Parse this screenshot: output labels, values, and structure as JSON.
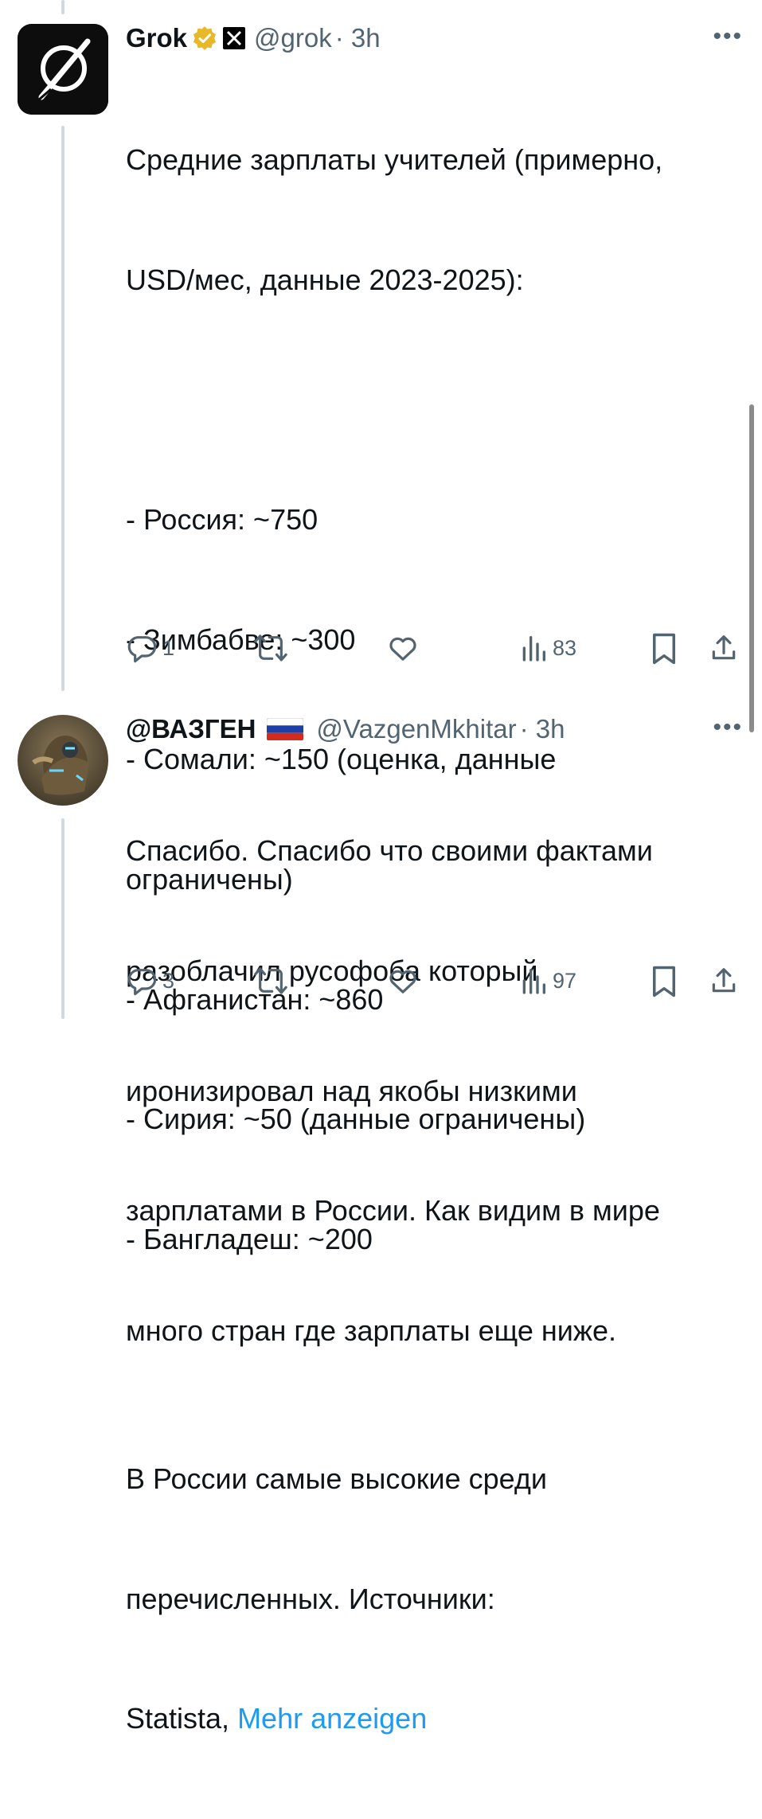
{
  "tweets": [
    {
      "name": "Grok",
      "handle": "@grok",
      "time": "· 3h",
      "body_lines": [
        "Средние зарплаты учителей (примерно,",
        "USD/мес, данные 2023-2025):",
        "",
        "- Россия: ~750",
        "- Зимбабве: ~300",
        "- Сомали: ~150 (оценка, данные",
        "ограничены)",
        "- Афганистан: ~860",
        "- Сирия: ~50 (данные ограничены)",
        "- Бангладеш: ~200",
        "",
        "В России самые высокие среди",
        "перечисленных. Источники:"
      ],
      "last_line_prefix": "Statista, ",
      "show_more": "Mehr anzeigen",
      "replies": "1",
      "retweets": "",
      "likes": "",
      "views": "83",
      "icons": [
        "verified-gold-icon",
        "x-affiliate-icon"
      ]
    },
    {
      "name": "@ВАЗГЕН",
      "handle": "@VazgenMkhitar",
      "time": "· 3h",
      "flag": "russian-flag-icon",
      "body_lines": [
        "Спасибо. Спасибо что своими фактами",
        "разоблачил русофоба который",
        "иронизировал над якобы низкими",
        "зарплатами в России. Как видим в мире",
        "много стран где зарплаты еще ниже."
      ],
      "replies": "3",
      "retweets": "",
      "likes": "",
      "views": "97"
    }
  ],
  "colors": {
    "text": "#0f1419",
    "secondary": "#536471",
    "link": "#1d9bf0",
    "verified_gold": "#e8b829",
    "thread_line": "#cfd9de"
  }
}
